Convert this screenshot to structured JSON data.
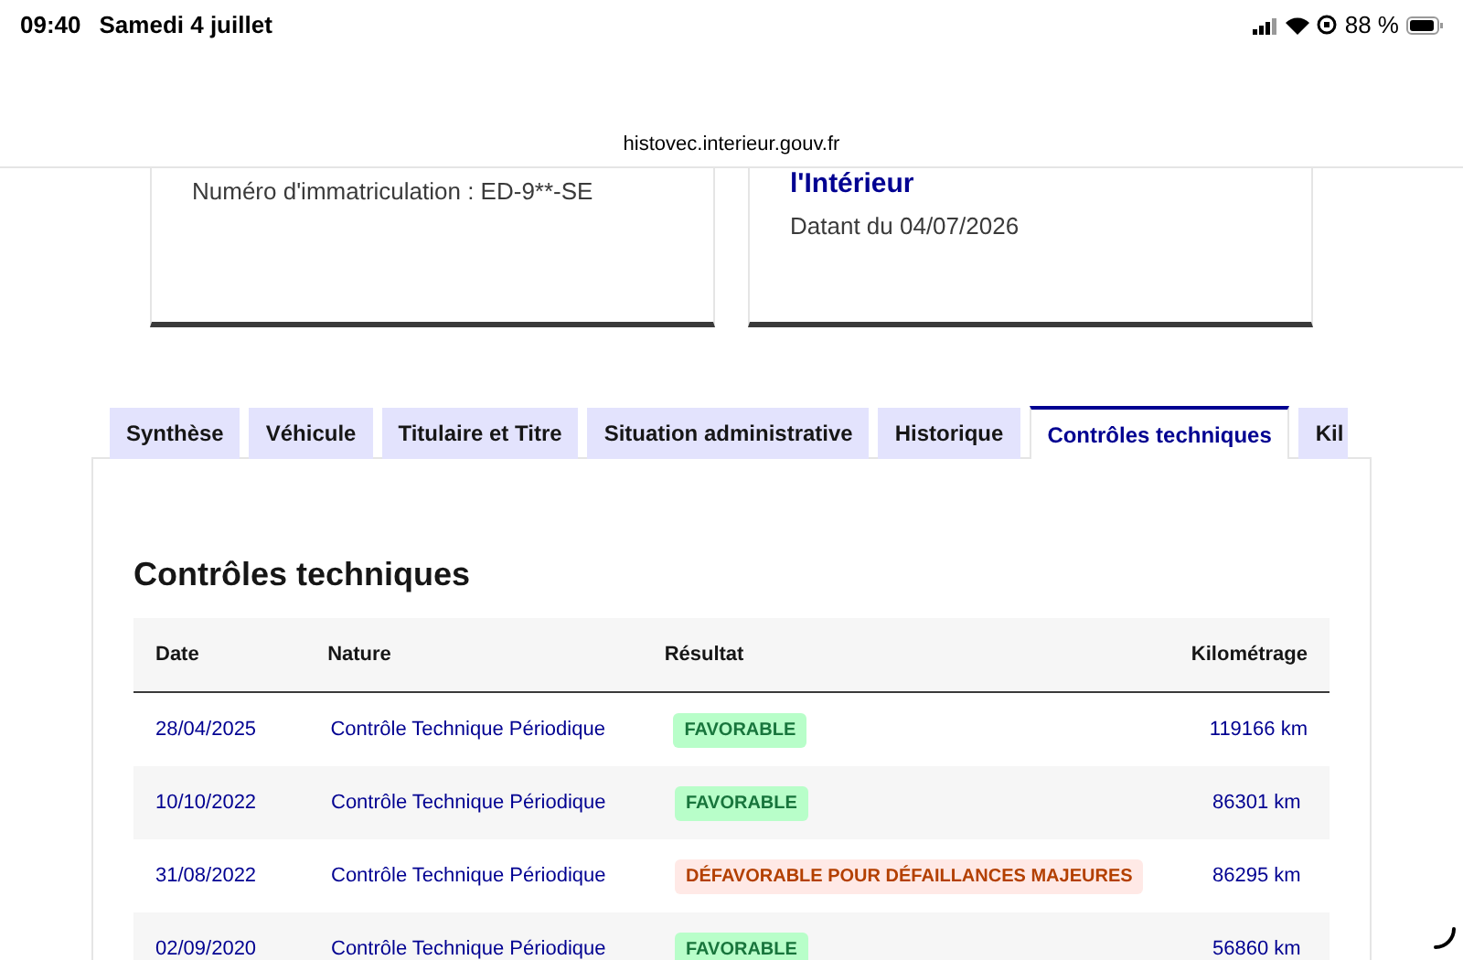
{
  "status_bar": {
    "time": "09:40",
    "date": "Samedi 4 juillet",
    "battery": "88 %"
  },
  "address_bar": {
    "url": "histovec.interieur.gouv.fr"
  },
  "cards": [
    {
      "text": "Numéro d'immatriculation : ED-9**-SE"
    },
    {
      "title": "l'Intérieur",
      "text": "Datant du 04/07/2026"
    }
  ],
  "tabs": [
    {
      "label": "Synthèse",
      "selected": false
    },
    {
      "label": "Véhicule",
      "selected": false
    },
    {
      "label": "Titulaire et Titre",
      "selected": false
    },
    {
      "label": "Situation administrative",
      "selected": false
    },
    {
      "label": "Historique",
      "selected": false
    },
    {
      "label": "Contrôles techniques",
      "selected": true
    },
    {
      "label": "Kil",
      "selected": false
    }
  ],
  "section_title": "Contrôles techniques",
  "table": {
    "columns": [
      "Date",
      "Nature",
      "Résultat",
      "Kilométrage"
    ],
    "rows": [
      {
        "date": "28/04/2025",
        "nature": "Contrôle Technique Périodique",
        "result": {
          "label": "FAVORABLE",
          "kind": "success"
        },
        "mileage": "119166 km"
      },
      {
        "date": "10/10/2022",
        "nature": "Contrôle Technique Périodique",
        "result": {
          "label": "FAVORABLE",
          "kind": "success"
        },
        "mileage": "86301 km"
      },
      {
        "date": "31/08/2022",
        "nature": "Contrôle Technique Périodique",
        "result": {
          "label": "DÉFAVORABLE POUR DÉFAILLANCES MAJEURES",
          "kind": "error"
        },
        "mileage": "86295 km"
      },
      {
        "date": "02/09/2020",
        "nature": "Contrôle Technique Périodique",
        "result": {
          "label": "FAVORABLE",
          "kind": "success"
        },
        "mileage": "56860 km"
      }
    ]
  }
}
